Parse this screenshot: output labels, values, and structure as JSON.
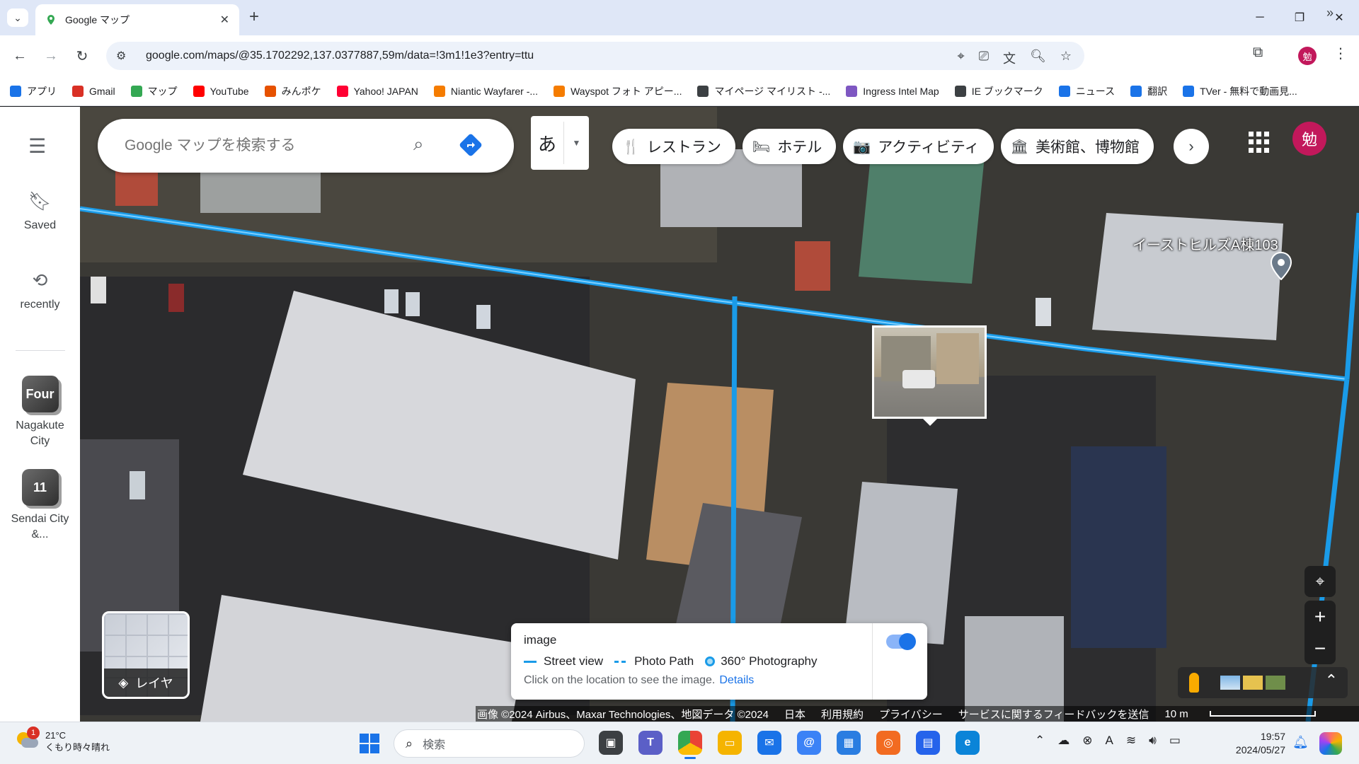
{
  "browser": {
    "tab_title": "Google マップ",
    "url": "google.com/maps/@35.1702292,137.0377887,59m/data=!3m1!1e3?entry=ttu",
    "profile_initial": "勉",
    "bookmarks": [
      {
        "label": "アプリ",
        "icon": "apps-grid-icon",
        "color": "#1a73e8"
      },
      {
        "label": "Gmail",
        "icon": "gmail-icon",
        "color": "#d93025"
      },
      {
        "label": "マップ",
        "icon": "maps-pin-icon",
        "color": "#34a853"
      },
      {
        "label": "YouTube",
        "icon": "youtube-icon",
        "color": "#ff0000"
      },
      {
        "label": "みんポケ",
        "icon": "pokeball-icon",
        "color": "#e65100"
      },
      {
        "label": "Yahoo! JAPAN",
        "icon": "yahoo-icon",
        "color": "#ff0033"
      },
      {
        "label": "Niantic Wayfarer -...",
        "icon": "wayfarer-icon",
        "color": "#f57c00"
      },
      {
        "label": "Wayspot フォト アピー...",
        "icon": "wayspot-icon",
        "color": "#f57c00"
      },
      {
        "label": "マイページ マイリスト -...",
        "icon": "mypage-icon",
        "color": "#3c4043"
      },
      {
        "label": "Ingress Intel Map",
        "icon": "ingress-icon",
        "color": "#7e57c2"
      },
      {
        "label": "IE ブックマーク",
        "icon": "folder-icon",
        "color": "#3c4043"
      },
      {
        "label": "ニュース",
        "icon": "news-icon",
        "color": "#1a73e8"
      },
      {
        "label": "翻訳",
        "icon": "translate-icon",
        "color": "#1a73e8"
      },
      {
        "label": "TVer - 無料で動画見...",
        "icon": "tver-icon",
        "color": "#1a73e8"
      }
    ]
  },
  "maps": {
    "search_placeholder": "Google マップを検索する",
    "ime_char": "あ",
    "chips": [
      {
        "label": "レストラン",
        "icon": "restaurant-icon",
        "glyph": "🍴"
      },
      {
        "label": "ホテル",
        "icon": "hotel-icon",
        "glyph": "🛏"
      },
      {
        "label": "アクティビティ",
        "icon": "camera-icon",
        "glyph": "📷"
      },
      {
        "label": "美術館、博物館",
        "icon": "museum-icon",
        "glyph": "🏛"
      }
    ],
    "account_initial": "勉",
    "rail": {
      "saved": "Saved",
      "recently": "recently",
      "recent_places": [
        {
          "thumb": "Four",
          "label_line1": "Nagakute",
          "label_line2": "City"
        },
        {
          "thumb": "11",
          "label_line1": "Sendai City",
          "label_line2": "&..."
        }
      ]
    },
    "place_label": "イーストヒルズA棟103",
    "layers_label": "レイヤ",
    "street_view_card": {
      "title": "image",
      "legend": [
        "Street view",
        "Photo Path",
        "360° Photography"
      ],
      "hint": "Click on the location to see the image.",
      "details_link": "Details",
      "toggle_on": true
    },
    "attribution": {
      "imagery": "画像 ©2024 Airbus、Maxar Technologies、地図データ ©2024",
      "region": "日本",
      "terms": "利用規約",
      "privacy": "プライバシー",
      "feedback": "サービスに関するフィードバックを送信",
      "scale": "10 m"
    },
    "colors": {
      "street_view_line": "#1a9be8",
      "accent": "#1a73e8"
    }
  },
  "taskbar": {
    "weather_badge": "1",
    "temperature": "21°C",
    "weather_desc": "くもり時々晴れ",
    "search_placeholder": "検索",
    "time": "19:57",
    "date": "2024/05/27",
    "ime_indicator": "A"
  }
}
